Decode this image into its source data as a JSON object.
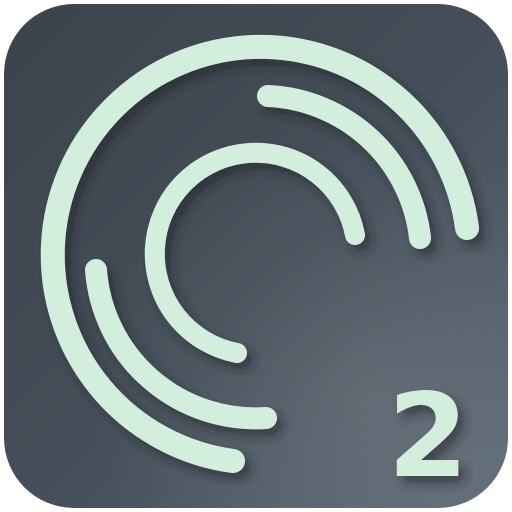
{
  "app_icon": {
    "badge_number": "2",
    "icons": {
      "main": "concentric-rings-icon",
      "outer": "outer-ring-arc-icon",
      "middle": "middle-ring-arc-icon",
      "inner": "inner-ring-arc-icon"
    },
    "colors": {
      "background_dark": "#3f4850",
      "background_light": "#5b6670",
      "foreground": "#d3eedd"
    }
  }
}
